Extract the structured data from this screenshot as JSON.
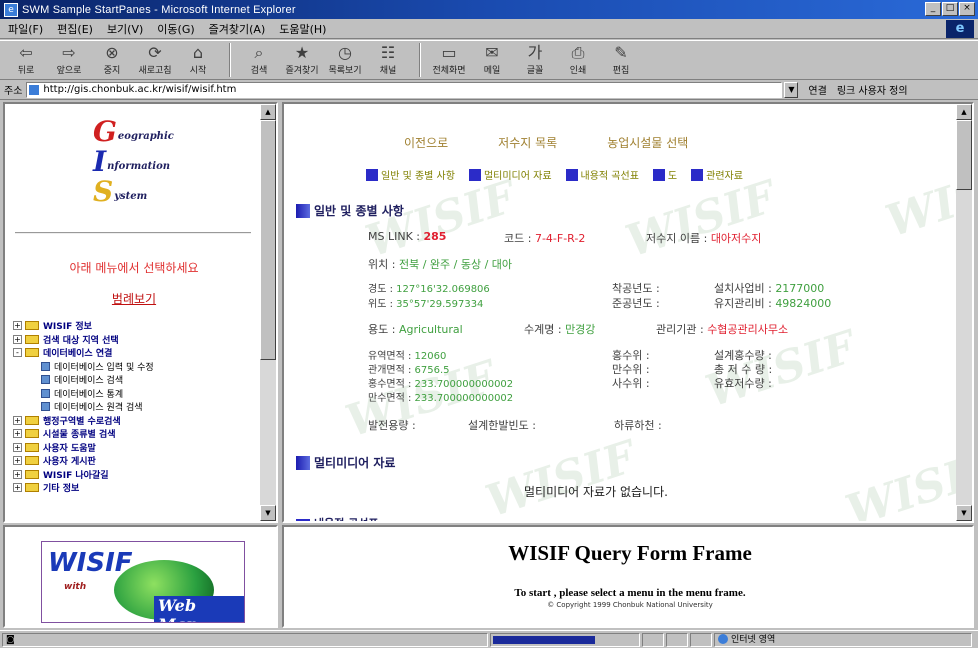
{
  "window": {
    "title": "SWM Sample StartPanes - Microsoft Internet Explorer",
    "buttons": [
      "_",
      "□",
      "×"
    ]
  },
  "menubar": {
    "items": [
      "파일(F)",
      "편집(E)",
      "보기(V)",
      "이동(G)",
      "즐겨찾기(A)",
      "도움말(H)"
    ]
  },
  "toolbar": {
    "buttons": [
      {
        "label": "뒤로",
        "icon": "back-arrow-icon",
        "glyph": "⇦"
      },
      {
        "label": "앞으로",
        "icon": "forward-arrow-icon",
        "glyph": "⇨"
      },
      {
        "label": "중지",
        "icon": "stop-icon",
        "glyph": "⊗"
      },
      {
        "label": "새로고침",
        "icon": "refresh-icon",
        "glyph": "⟳"
      },
      {
        "label": "시작",
        "icon": "home-icon",
        "glyph": "⌂"
      },
      {
        "label": "검색",
        "icon": "search-icon",
        "glyph": "⌕"
      },
      {
        "label": "즐겨찾기",
        "icon": "favorites-icon",
        "glyph": "★"
      },
      {
        "label": "목록보기",
        "icon": "history-icon",
        "glyph": "◷"
      },
      {
        "label": "채널",
        "icon": "channels-icon",
        "glyph": "☷"
      },
      {
        "label": "전체화면",
        "icon": "fullscreen-icon",
        "glyph": "▭"
      },
      {
        "label": "메일",
        "icon": "mail-icon",
        "glyph": "✉"
      },
      {
        "label": "글꼴",
        "icon": "font-icon",
        "glyph": "가"
      },
      {
        "label": "인쇄",
        "icon": "print-icon",
        "glyph": "⎙"
      },
      {
        "label": "편집",
        "icon": "edit-icon",
        "glyph": "✎"
      }
    ]
  },
  "address": {
    "label": "주소",
    "url": "http://gis.chonbuk.ac.kr/wisif/wisif.htm",
    "go_label": "연결",
    "links_label": "링크 사용자 정의"
  },
  "left_frame": {
    "logo": {
      "lines": [
        {
          "letter": "G",
          "rest": "eographic",
          "color": "#d02020"
        },
        {
          "letter": "I",
          "rest": "nformation",
          "color": "#1a2ab0"
        },
        {
          "letter": "S",
          "rest": "ystem",
          "color": "#e0b020"
        }
      ]
    },
    "select_prompt": "아래 메뉴에서 선택하세요",
    "legend_link": "범례보기",
    "tree": [
      {
        "label": "WISIF 정보",
        "level": 0,
        "toggle": "+"
      },
      {
        "label": "검색 대상 지역 선택",
        "level": 0,
        "toggle": "+"
      },
      {
        "label": "데이터베이스 연결",
        "level": 0,
        "toggle": "-"
      },
      {
        "label": "데이터베이스 입력 및 수정",
        "level": 1
      },
      {
        "label": "데이터베이스 검색",
        "level": 1
      },
      {
        "label": "데이터베이스 통계",
        "level": 1
      },
      {
        "label": "데이터베이스 원격 검색",
        "level": 1
      },
      {
        "label": "행정구역별 수로검색",
        "level": 0,
        "toggle": "+"
      },
      {
        "label": "시설물 종류별 검색",
        "level": 0,
        "toggle": "+"
      },
      {
        "label": "사용자 도움말",
        "level": 0,
        "toggle": "+"
      },
      {
        "label": "사용자 게시판",
        "level": 0,
        "toggle": "+"
      },
      {
        "label": "WISIF 나아갈길",
        "level": 0,
        "toggle": "+"
      },
      {
        "label": "기타 정보",
        "level": 0,
        "toggle": "+"
      }
    ]
  },
  "main": {
    "nav_links": [
      "이전으로",
      "저수지 목록",
      "농업시설물 선택"
    ],
    "tabs": [
      "일반 및 종별 사항",
      "멀티미디어 자료",
      "내용적 곡선표",
      "도",
      "관련자료"
    ],
    "section_general": "일반 및 종별 사항",
    "mslink_label": "MS LINK :",
    "mslink_value": "285",
    "code_label": "코드 :",
    "code_value": "7-4-F-R-2",
    "reservoir_name_label": "저수지 이름 :",
    "reservoir_name_value": "대아저수지",
    "location_label": "위치 :",
    "location_value": "전북 / 완주 / 동상 / 대아",
    "longitude_label": "경도 :",
    "longitude_value": "127°16'32.069806",
    "latitude_label": "위도 :",
    "latitude_value": "35°57'29.597334",
    "start_year_label": "착공년도 :",
    "end_year_label": "준공년도 :",
    "build_cost_label": "설치사업비 :",
    "build_cost_value": "2177000",
    "maint_cost_label": "유지관리비 :",
    "maint_cost_value": "49824000",
    "usage_label": "용도 :",
    "usage_value": "Agricultural",
    "water_system_label": "수계명 :",
    "water_system_value": "만경강",
    "manager_label": "관리기관 :",
    "manager_value": "수협공관리사무소",
    "basin_area_label": "유역면적 :",
    "basin_area_value": "12060",
    "irrigation_area_label": "관개면적 :",
    "irrigation_area_value": "6756.5",
    "flood_area_label": "홍수면적 :",
    "flood_area_value": "233.700000000002",
    "full_area_label": "만수면적 :",
    "full_area_value": "233.700000000002",
    "flood_level_label": "홍수위 :",
    "full_level_label": "만수위 :",
    "dead_level_label": "사수위 :",
    "design_flood_label": "설계홍수량 :",
    "total_storage_label": "총 저 수 량 :",
    "effective_storage_label": "유효저수량 :",
    "power_capacity_label": "발전용량 :",
    "design_frequency_label": "설계한발빈도 :",
    "downstream_river_label": "하류하천 :",
    "section_multimedia": "멀티미디어 자료",
    "no_multimedia": "멀티미디어 자료가 없습니다.",
    "section_partial": "내용적 곡선표",
    "watermark": "WISIF"
  },
  "bottom_left": {
    "logo_word": "WISIF",
    "logo_with": "with",
    "logo_webmap": "Web Map"
  },
  "bottom_right": {
    "title": "WISIF Query Form Frame",
    "subtitle": "To start , please select a menu in the menu frame.",
    "copyright": "© Copyright 1999 Chonbuk National University"
  },
  "statusbar": {
    "progress": 0.7,
    "zone_label": "인터넷 영역"
  },
  "colors": {
    "accent_blue": "#2b2bc8",
    "red_value": "#e02030",
    "green_value": "#40a040"
  }
}
